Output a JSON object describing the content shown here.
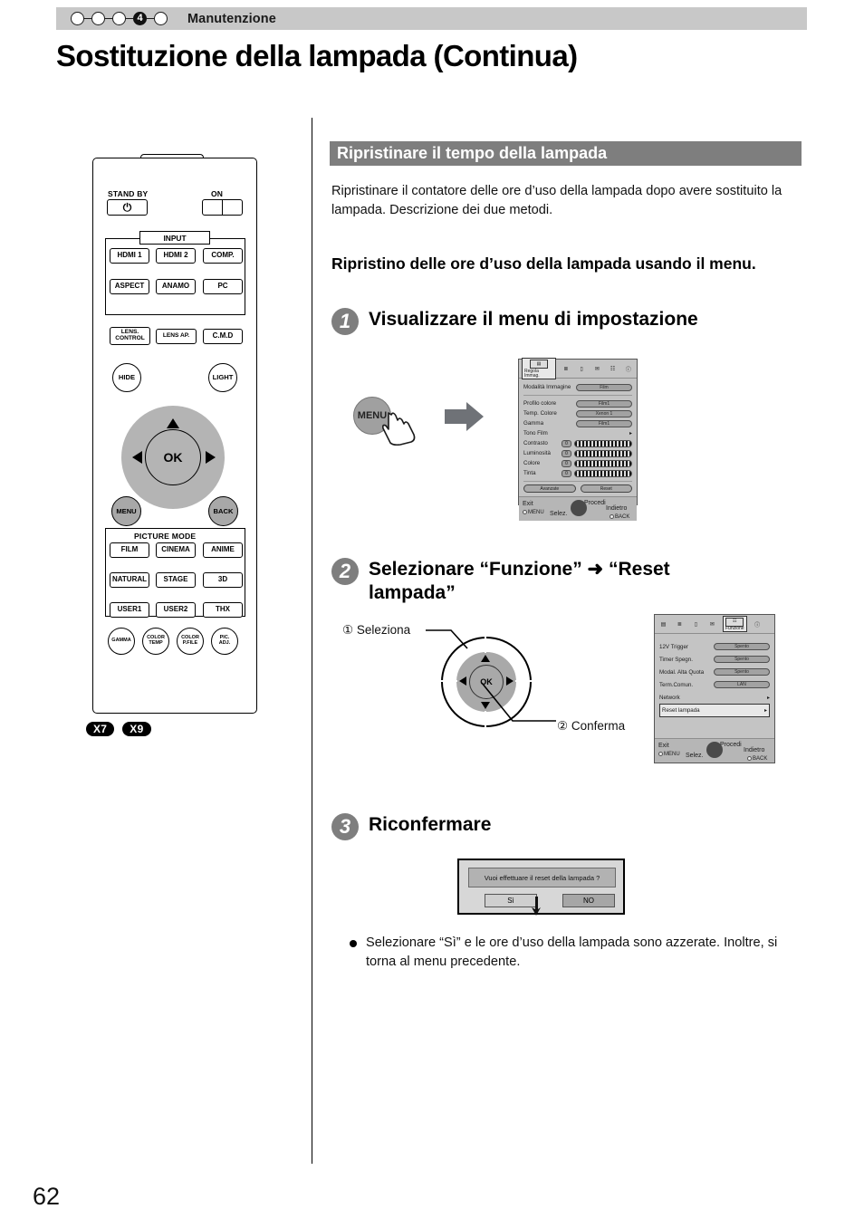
{
  "header": {
    "chapter_title": "Manutenzione",
    "active_step": "4",
    "dots_total": 5
  },
  "page_title": "Sostituzione della lampada (Continua)",
  "page_number": "62",
  "section": {
    "heading": "Ripristinare il tempo della lampada",
    "intro": "Ripristinare il contatore delle ore d’uso della lampada dopo avere sostituito la lampada. Descrizione dei due metodi.",
    "method_title": "Ripristino delle ore d’uso della lampada usando il menu."
  },
  "steps": [
    {
      "num": "1",
      "text": "Visualizzare il menu di impostazione"
    },
    {
      "num": "2",
      "text": "Selezionare “Funzione” ➜ “Reset lampada”"
    },
    {
      "num": "3",
      "text": "Riconfermare"
    }
  ],
  "step1": {
    "menu_key_label": "MENU",
    "arrow_icon": "right-arrow-icon"
  },
  "osd_picture": {
    "tab_label": "Regola Immag.",
    "tabs": [
      "picture-icon",
      "setup-icon",
      "display-icon",
      "lens-icon",
      "function-icon",
      "info-icon"
    ],
    "rows_top": [
      {
        "name": "Modalità Immagine",
        "value": "Film"
      }
    ],
    "rows_mid": [
      {
        "name": "Profilo colore",
        "value": "Film1"
      },
      {
        "name": "Temp. Colore",
        "value": "Xenon 1"
      },
      {
        "name": "Gamma",
        "value": "Film1"
      }
    ],
    "row_submenu": {
      "name": "Tono Film"
    },
    "rows_slider": [
      {
        "name": "Contrasto",
        "value": "0"
      },
      {
        "name": "Luminosità",
        "value": "0"
      },
      {
        "name": "Colore",
        "value": "0"
      },
      {
        "name": "Tinta",
        "value": "0"
      }
    ],
    "buttons": [
      {
        "label": "Avanzate"
      },
      {
        "label": "Reset"
      }
    ],
    "footer": {
      "exit": "Exit",
      "exit_key": "MENU",
      "select": "Selez.",
      "proceed": "Procedi",
      "back": "Indietro",
      "back_key": "BACK"
    }
  },
  "osd_function": {
    "tab_label": "Funzione",
    "rows": [
      {
        "name": "12V Trigger",
        "value": "Spento",
        "type": "value"
      },
      {
        "name": "Timer Spegn.",
        "value": "Spento",
        "type": "value"
      },
      {
        "name": "Modal. Alta Quota",
        "value": "Spento",
        "type": "value"
      },
      {
        "name": "Term.Comun.",
        "value": "LAN",
        "type": "value"
      },
      {
        "name": "Network",
        "value": "",
        "type": "submenu"
      },
      {
        "name": "Reset lampada",
        "value": "",
        "type": "submenu-highlight"
      }
    ],
    "footer": {
      "exit": "Exit",
      "exit_key": "MENU",
      "select": "Selez.",
      "proceed": "Procedi",
      "back": "Indietro",
      "back_key": "BACK"
    }
  },
  "step2_callouts": {
    "select": "① Seleziona",
    "confirm": "② Conferma",
    "ok_label": "OK"
  },
  "confirm_dialog": {
    "message": "Vuoi effettuare il reset della lampada ?",
    "yes": "Sì",
    "no": "NO"
  },
  "note": "Selezionare “Sì” e le ore d’uso della lampada sono azzerate. Inoltre, si torna al menu precedente.",
  "remote": {
    "standby_label": "STAND BY",
    "on_label": "ON",
    "power_icon": "power-icon",
    "input_group_label": "INPUT",
    "input_buttons": [
      "HDMI 1",
      "HDMI 2",
      "COMP.",
      "ASPECT",
      "ANAMO",
      "PC"
    ],
    "lens_row": [
      "LENS. CONTROL",
      "LENS AP.",
      "C.M.D"
    ],
    "hide_label": "HIDE",
    "light_label": "LIGHT",
    "ok_label": "OK",
    "menu_label": "MENU",
    "back_label": "BACK",
    "picture_mode_label": "PICTURE MODE",
    "picture_mode_buttons": [
      "FILM",
      "CINEMA",
      "ANIME",
      "NATURAL",
      "STAGE",
      "3D",
      "USER1",
      "USER2",
      "THX"
    ],
    "round_buttons": [
      "GAMMA",
      "COLOR TEMP",
      "COLOR P.FILE",
      "PIC. ADJ."
    ],
    "model_badges": [
      "X7",
      "X9"
    ]
  },
  "colors": {
    "header_bar": "#c8c8c8",
    "section_bar": "#7e7e7e",
    "step_circle": "#7e7e7e",
    "osd_bg": "#c4c4c4"
  }
}
